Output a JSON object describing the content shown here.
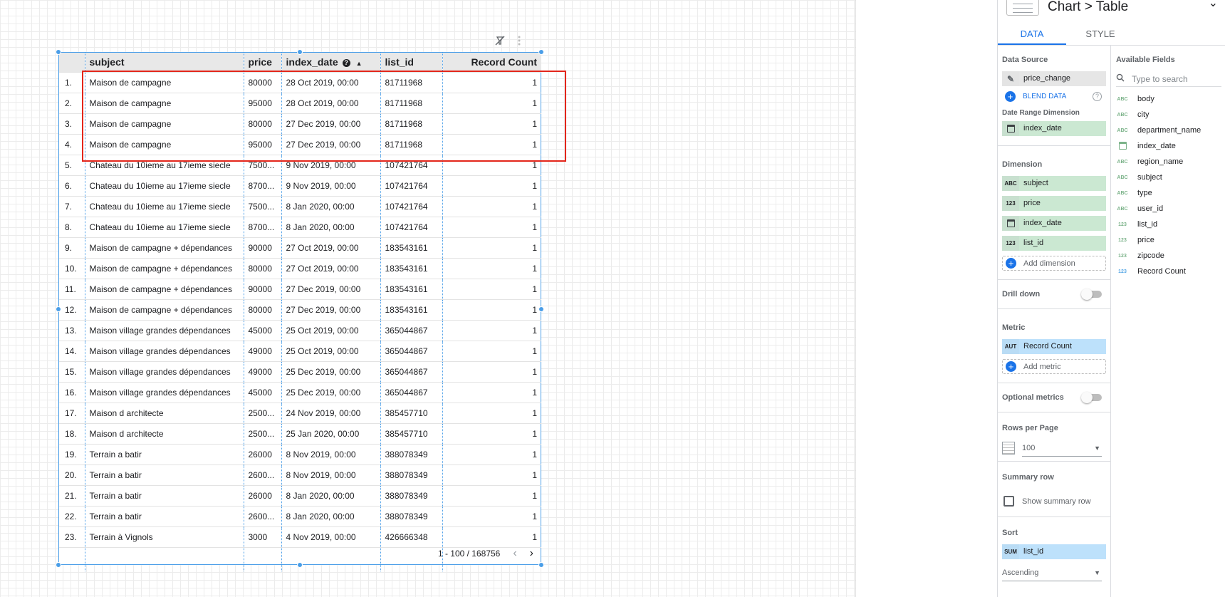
{
  "table": {
    "columns": [
      "subject",
      "price",
      "index_date",
      "list_id",
      "Record Count"
    ],
    "help_glyph": "?",
    "sort_glyph": "▲",
    "rows": [
      [
        "1.",
        "Maison de campagne",
        "80000",
        "28 Oct 2019, 00:00",
        "81711968",
        "1"
      ],
      [
        "2.",
        "Maison de campagne",
        "95000",
        "28 Oct 2019, 00:00",
        "81711968",
        "1"
      ],
      [
        "3.",
        "Maison de campagne",
        "80000",
        "27 Dec 2019, 00:00",
        "81711968",
        "1"
      ],
      [
        "4.",
        "Maison de campagne",
        "95000",
        "27 Dec 2019, 00:00",
        "81711968",
        "1"
      ],
      [
        "5.",
        "Chateau du 10ieme au 17ieme siecle",
        "7500...",
        "9 Nov 2019, 00:00",
        "107421764",
        "1"
      ],
      [
        "6.",
        "Chateau du 10ieme au 17ieme siecle",
        "8700...",
        "9 Nov 2019, 00:00",
        "107421764",
        "1"
      ],
      [
        "7.",
        "Chateau du 10ieme au 17ieme siecle",
        "7500...",
        "8 Jan 2020, 00:00",
        "107421764",
        "1"
      ],
      [
        "8.",
        "Chateau du 10ieme au 17ieme siecle",
        "8700...",
        "8 Jan 2020, 00:00",
        "107421764",
        "1"
      ],
      [
        "9.",
        "Maison de campagne + dépendances",
        "90000",
        "27 Oct 2019, 00:00",
        "183543161",
        "1"
      ],
      [
        "10.",
        "Maison de campagne + dépendances",
        "80000",
        "27 Oct 2019, 00:00",
        "183543161",
        "1"
      ],
      [
        "11.",
        "Maison de campagne + dépendances",
        "90000",
        "27 Dec 2019, 00:00",
        "183543161",
        "1"
      ],
      [
        "12.",
        "Maison de campagne + dépendances",
        "80000",
        "27 Dec 2019, 00:00",
        "183543161",
        "1"
      ],
      [
        "13.",
        "Maison village grandes dépendances",
        "45000",
        "25 Oct 2019, 00:00",
        "365044867",
        "1"
      ],
      [
        "14.",
        "Maison village grandes dépendances",
        "49000",
        "25 Oct 2019, 00:00",
        "365044867",
        "1"
      ],
      [
        "15.",
        "Maison village grandes dépendances",
        "49000",
        "25 Dec 2019, 00:00",
        "365044867",
        "1"
      ],
      [
        "16.",
        "Maison village grandes dépendances",
        "45000",
        "25 Dec 2019, 00:00",
        "365044867",
        "1"
      ],
      [
        "17.",
        "Maison d architecte",
        "2500...",
        "24 Nov 2019, 00:00",
        "385457710",
        "1"
      ],
      [
        "18.",
        "Maison d architecte",
        "2500...",
        "25 Jan 2020, 00:00",
        "385457710",
        "1"
      ],
      [
        "19.",
        "Terrain a batir",
        "26000",
        "8 Nov 2019, 00:00",
        "388078349",
        "1"
      ],
      [
        "20.",
        "Terrain a batir",
        "2600...",
        "8 Nov 2019, 00:00",
        "388078349",
        "1"
      ],
      [
        "21.",
        "Terrain a batir",
        "26000",
        "8 Jan 2020, 00:00",
        "388078349",
        "1"
      ],
      [
        "22.",
        "Terrain a batir",
        "2600...",
        "8 Jan 2020, 00:00",
        "388078349",
        "1"
      ],
      [
        "23.",
        "Terrain à Vignols",
        "3000",
        "4 Nov 2019, 00:00",
        "426666348",
        "1"
      ]
    ],
    "pager": {
      "range": "1 - 100 / 168756",
      "prev": "‹",
      "next": "›"
    }
  },
  "panel": {
    "breadcrumb": "Chart > Table",
    "tabs": [
      "DATA",
      "STYLE"
    ],
    "data_source": {
      "title": "Data Source",
      "name": "price_change",
      "blend": "BLEND DATA",
      "help": "?"
    },
    "date_range": {
      "title": "Date Range Dimension",
      "field": "index_date"
    },
    "dimension": {
      "title": "Dimension",
      "chips": [
        {
          "tag": "ABC",
          "name": "subject"
        },
        {
          "tag": "123",
          "name": "price"
        },
        {
          "tag": "cal",
          "name": "index_date"
        },
        {
          "tag": "123",
          "name": "list_id"
        }
      ],
      "add": "Add dimension"
    },
    "drill_down": "Drill down",
    "metric": {
      "title": "Metric",
      "chip_tag": "AUT",
      "chip_name": "Record Count",
      "add": "Add metric"
    },
    "optional_metrics": "Optional metrics",
    "rows_per_page": {
      "title": "Rows per Page",
      "value": "100"
    },
    "summary_row": {
      "title": "Summary row",
      "checkbox": "Show summary row"
    },
    "sort": {
      "title": "Sort",
      "chip_tag": "SUM",
      "chip_name": "list_id",
      "order": "Ascending"
    },
    "available": {
      "title": "Available Fields",
      "search_placeholder": "Type to search",
      "fields": [
        {
          "type": "ABC",
          "name": "body"
        },
        {
          "type": "ABC",
          "name": "city"
        },
        {
          "type": "ABC",
          "name": "department_name"
        },
        {
          "type": "date",
          "name": "index_date"
        },
        {
          "type": "ABC",
          "name": "region_name"
        },
        {
          "type": "ABC",
          "name": "subject"
        },
        {
          "type": "ABC",
          "name": "type"
        },
        {
          "type": "ABC",
          "name": "user_id"
        },
        {
          "type": "123",
          "name": "list_id"
        },
        {
          "type": "123",
          "name": "price"
        },
        {
          "type": "123",
          "name": "zipcode"
        },
        {
          "type": "123b",
          "name": "Record Count"
        }
      ]
    }
  },
  "colors": {
    "accent": "#1a73e8",
    "selection": "#4a9ee8",
    "highlight": "#e3261b",
    "dimension_chip": "#cbe8d2",
    "metric_chip": "#bde1fb"
  }
}
